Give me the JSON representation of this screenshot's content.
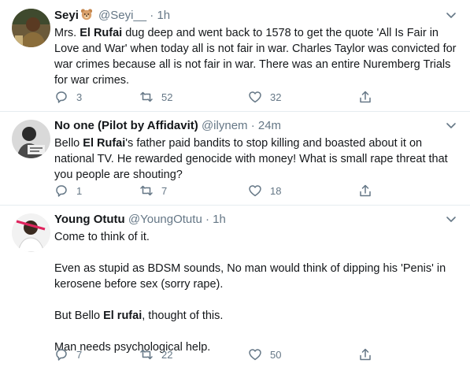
{
  "tweets": [
    {
      "name": "Seyi",
      "emoji_icon": "bear-face-icon",
      "handle": "@Seyi__",
      "separator": "·",
      "time": "1h",
      "text": [
        [
          "Mrs. ",
          "El Rufai",
          " dug deep and went back to 1578 to get the quote 'All Is Fair in Love and War' when today all is not fair in war. Charles Taylor was convicted for war crimes because all is not fair in war. There was an entire Nuremberg Trials for war crimes."
        ]
      ],
      "replies": "3",
      "retweets": "52",
      "likes": "32"
    },
    {
      "name": "No one (Pilot by Affidavit)",
      "handle": "@ilynem",
      "separator": "·",
      "time": "24m",
      "text": [
        [
          "Bello ",
          "El Rufai",
          "'s father paid bandits to stop killing and boasted about it on national TV. He rewarded genocide with money! What is small rape threat that you people are shouting?"
        ]
      ],
      "replies": "1",
      "retweets": "7",
      "likes": "18"
    },
    {
      "name": "Young Otutu",
      "handle": "@YoungOtutu",
      "separator": "·",
      "time": "1h",
      "text": [
        [
          "Come to think of it.",
          "",
          ""
        ],
        [
          "Even as stupid as BDSM sounds, No man would think of dipping his 'Penis' in kerosene before sex (sorry rape).",
          "",
          ""
        ],
        [
          "But Bello ",
          "El rufai",
          ", thought of this."
        ],
        [
          "Man needs psychological help.",
          "",
          ""
        ]
      ],
      "replies": "7",
      "retweets": "22",
      "likes": "50"
    }
  ]
}
